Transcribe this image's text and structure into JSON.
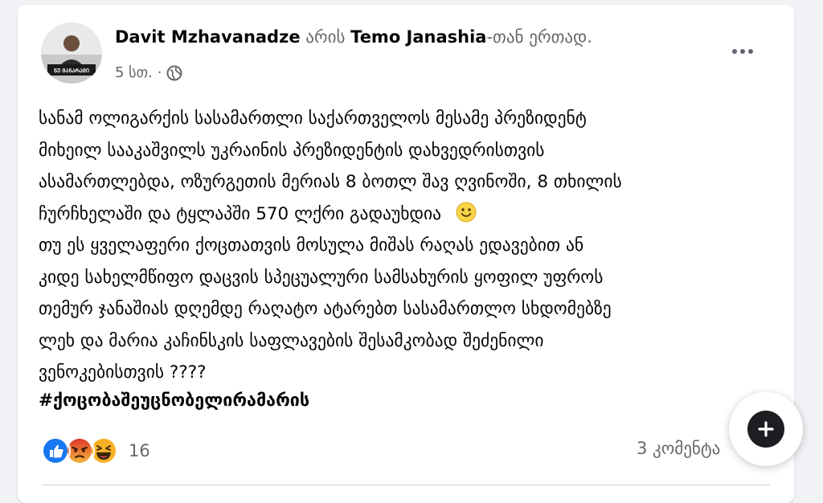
{
  "post": {
    "author": "Davit Mzhavanadze",
    "with_word": "არის",
    "tagged": "Temo Janashia",
    "with_suffix": "-თან ერთად.",
    "time": "5 სთ.",
    "separator": "·",
    "privacy_icon": "globe-icon",
    "avatar_caption": "ᲜᲣ ᲛᲐᲜᲐᲠᲐᲛᲘ",
    "lines": [
      "სანამ ოლიგარქის სასამართლი საქართველოს მესამე  პრეზიდენტ",
      "მიხეილ  სააკაშვილს  უკრაინის პრეზიდენტის დახვედრისთვის",
      "ასამართლებდა, ოზურგეთის მერიას 8 ბოთლ შავ ღვინოში, 8 თხილის",
      "ჩურჩხელაში და ტყლაპში 570 ლქრი გადაუხდია",
      "თუ ეს ყველაფერი ქოცთათვის მოსულა მიშას რაღას ედავებით ან",
      "კიდე  სახელმწიფო დაცვის სპეცუალური სამსახურის ყოფილ უფროს",
      "თემურ ჯანაშიას დღემდე რაღატო ატარებთ სასამართლო სხდომებზე",
      "ლეხ და მარია კაჩინსკის საფლავების შესამკობად შეძენილი",
      "ვენოკებისთვის   ????"
    ],
    "hashtag": "#ქოცობაშეუცნობელირამარის",
    "reaction_count": "16",
    "comments": "3 კომენტა"
  },
  "reactions": [
    "like-icon",
    "angry-icon",
    "haha-icon"
  ],
  "colors": {
    "background": "#f0f2f5",
    "card": "#ffffff",
    "text": "#050505",
    "muted": "#65676b",
    "like_blue": "#1877f2",
    "angry_orange": "#e9710f",
    "haha_yellow": "#f7b125"
  }
}
